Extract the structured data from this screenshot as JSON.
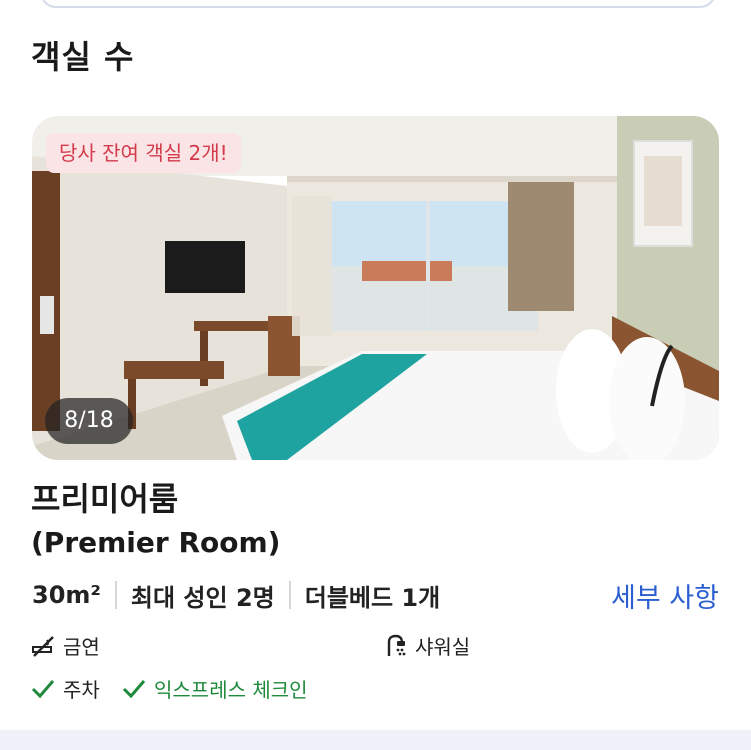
{
  "section": {
    "title": "객실 수"
  },
  "room": {
    "badge": "당사 잔여 객실 2개!",
    "photo_counter": "8/18",
    "name_ko": "프리미어룸",
    "name_en": "(Premier Room)",
    "specs": {
      "size": "30m²",
      "occupancy": "최대 성인 2명",
      "bed": "더블베드 1개"
    },
    "detail_link": "세부 사항",
    "amenities": {
      "no_smoking": "금연",
      "shower": "샤워실",
      "parking": "주차",
      "express_checkin": "익스프레스 체크인"
    }
  },
  "colors": {
    "link": "#2b5fd1",
    "badge_text": "#d33a4b",
    "badge_bg": "#fbe4e5",
    "check": "#1f8a3b"
  }
}
